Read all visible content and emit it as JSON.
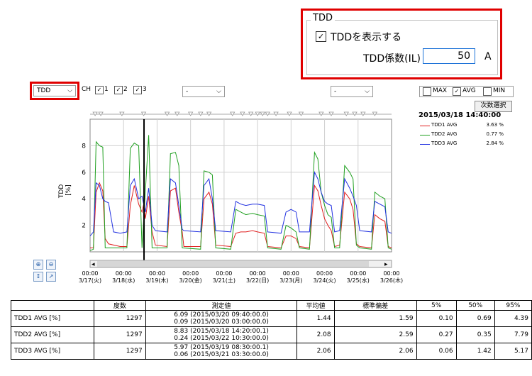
{
  "tdd_settings": {
    "group_title": "TDD",
    "show_checked": true,
    "show_label": "TDDを表示する",
    "coef_label": "TDD係数(IL)",
    "coef_value": "50",
    "coef_unit": "A"
  },
  "toolbar": {
    "mode_value": "TDD",
    "ch_label": "CH",
    "channels": [
      {
        "label": "1",
        "checked": true
      },
      {
        "label": "2",
        "checked": true
      },
      {
        "label": "3",
        "checked": true
      }
    ],
    "combo_a_value": "-",
    "combo_b_value": "-"
  },
  "stat_options": [
    {
      "label": "MAX",
      "checked": false
    },
    {
      "label": "AVG",
      "checked": true
    },
    {
      "label": "MIN",
      "checked": false
    }
  ],
  "next_button_label": "次数選択",
  "cursor_time": "2015/03/18 14:40:00",
  "legend": [
    {
      "name": "TDD1 AVG",
      "value": "3.63 %",
      "color": "#e02020"
    },
    {
      "name": "TDD2 AVG",
      "value": "0.77 %",
      "color": "#20a020"
    },
    {
      "name": "TDD3 AVG",
      "value": "2.84 %",
      "color": "#2030e0"
    }
  ],
  "chart_data": {
    "type": "line",
    "ylabel": "TDD [%]",
    "ylim": [
      0,
      10
    ],
    "yticks": [
      "2",
      "4",
      "6",
      "8"
    ],
    "x_ticks": [
      {
        "time": "00:00",
        "date": "3/17(火)"
      },
      {
        "time": "00:00",
        "date": "3/18(水)"
      },
      {
        "time": "00:00",
        "date": "3/19(木)"
      },
      {
        "time": "00:00",
        "date": "3/20(金)"
      },
      {
        "time": "00:00",
        "date": "3/21(土)"
      },
      {
        "time": "00:00",
        "date": "3/22(日)"
      },
      {
        "time": "00:00",
        "date": "3/23(月)"
      },
      {
        "time": "00:00",
        "date": "3/24(火)"
      },
      {
        "time": "00:00",
        "date": "3/25(水)"
      },
      {
        "time": "00:00",
        "date": "3/26(木)"
      }
    ],
    "x_range_days": [
      0,
      9
    ],
    "cursor_day": 1.61,
    "series": [
      {
        "name": "TDD1 AVG",
        "color": "#e02020",
        "points": [
          [
            0,
            0.3
          ],
          [
            0.1,
            0.3
          ],
          [
            0.18,
            4.5
          ],
          [
            0.28,
            5.2
          ],
          [
            0.38,
            4.6
          ],
          [
            0.45,
            1.0
          ],
          [
            0.55,
            0.6
          ],
          [
            0.9,
            0.4
          ],
          [
            1.1,
            0.4
          ],
          [
            1.2,
            3.5
          ],
          [
            1.32,
            5.0
          ],
          [
            1.45,
            3.6
          ],
          [
            1.55,
            3.0
          ],
          [
            1.6,
            3.6
          ],
          [
            1.65,
            2.5
          ],
          [
            1.75,
            4.2
          ],
          [
            1.85,
            1.5
          ],
          [
            1.95,
            0.5
          ],
          [
            2.3,
            0.4
          ],
          [
            2.4,
            4.6
          ],
          [
            2.55,
            4.8
          ],
          [
            2.65,
            3.0
          ],
          [
            2.75,
            1.5
          ],
          [
            2.8,
            0.4
          ],
          [
            3.3,
            0.4
          ],
          [
            3.4,
            4.0
          ],
          [
            3.55,
            4.5
          ],
          [
            3.65,
            3.6
          ],
          [
            3.75,
            0.5
          ],
          [
            4.2,
            0.4
          ],
          [
            4.35,
            1.4
          ],
          [
            4.5,
            1.5
          ],
          [
            4.65,
            1.5
          ],
          [
            4.85,
            1.6
          ],
          [
            5.0,
            1.5
          ],
          [
            5.2,
            1.4
          ],
          [
            5.3,
            0.4
          ],
          [
            5.7,
            0.3
          ],
          [
            5.85,
            1.2
          ],
          [
            6.0,
            1.2
          ],
          [
            6.15,
            1.0
          ],
          [
            6.25,
            0.4
          ],
          [
            6.55,
            0.3
          ],
          [
            6.7,
            5.0
          ],
          [
            6.8,
            4.6
          ],
          [
            6.9,
            3.5
          ],
          [
            7.0,
            2.5
          ],
          [
            7.1,
            2.0
          ],
          [
            7.2,
            1.6
          ],
          [
            7.3,
            0.4
          ],
          [
            7.45,
            0.5
          ],
          [
            7.6,
            4.5
          ],
          [
            7.75,
            4.0
          ],
          [
            7.85,
            3.2
          ],
          [
            7.95,
            0.6
          ],
          [
            8.05,
            0.4
          ],
          [
            8.4,
            0.3
          ],
          [
            8.5,
            2.8
          ],
          [
            8.65,
            2.5
          ],
          [
            8.8,
            2.3
          ],
          [
            8.9,
            0.4
          ],
          [
            9,
            0.3
          ]
        ]
      },
      {
        "name": "TDD2 AVG",
        "color": "#20a020",
        "points": [
          [
            0,
            0.1
          ],
          [
            0.1,
            0.2
          ],
          [
            0.18,
            8.3
          ],
          [
            0.28,
            8.0
          ],
          [
            0.38,
            7.9
          ],
          [
            0.45,
            0.3
          ],
          [
            0.9,
            0.3
          ],
          [
            1.1,
            0.3
          ],
          [
            1.2,
            7.8
          ],
          [
            1.32,
            8.2
          ],
          [
            1.45,
            8.0
          ],
          [
            1.55,
            0.3
          ],
          [
            1.75,
            8.8
          ],
          [
            1.85,
            0.3
          ],
          [
            2.3,
            0.3
          ],
          [
            2.4,
            7.4
          ],
          [
            2.55,
            7.5
          ],
          [
            2.65,
            6.5
          ],
          [
            2.75,
            0.3
          ],
          [
            3.3,
            0.2
          ],
          [
            3.4,
            6.1
          ],
          [
            3.55,
            6.0
          ],
          [
            3.65,
            5.8
          ],
          [
            3.75,
            0.3
          ],
          [
            4.2,
            0.2
          ],
          [
            4.35,
            3.2
          ],
          [
            4.5,
            3.0
          ],
          [
            4.65,
            2.8
          ],
          [
            4.85,
            2.9
          ],
          [
            5.0,
            2.8
          ],
          [
            5.2,
            2.7
          ],
          [
            5.3,
            0.3
          ],
          [
            5.7,
            0.2
          ],
          [
            5.85,
            2.0
          ],
          [
            6.0,
            1.8
          ],
          [
            6.15,
            1.5
          ],
          [
            6.25,
            0.3
          ],
          [
            6.55,
            0.2
          ],
          [
            6.7,
            7.5
          ],
          [
            6.8,
            7.0
          ],
          [
            6.9,
            4.5
          ],
          [
            7.0,
            3.5
          ],
          [
            7.1,
            2.8
          ],
          [
            7.2,
            2.6
          ],
          [
            7.3,
            0.3
          ],
          [
            7.45,
            0.3
          ],
          [
            7.6,
            6.5
          ],
          [
            7.75,
            6.0
          ],
          [
            7.85,
            5.5
          ],
          [
            7.95,
            0.5
          ],
          [
            8.05,
            0.3
          ],
          [
            8.4,
            0.2
          ],
          [
            8.5,
            4.5
          ],
          [
            8.65,
            4.2
          ],
          [
            8.8,
            4.0
          ],
          [
            8.9,
            0.3
          ],
          [
            9,
            0.2
          ]
        ]
      },
      {
        "name": "TDD3 AVG",
        "color": "#2030e0",
        "points": [
          [
            0,
            1.2
          ],
          [
            0.1,
            1.5
          ],
          [
            0.18,
            5.2
          ],
          [
            0.28,
            5.0
          ],
          [
            0.38,
            4.0
          ],
          [
            0.45,
            3.8
          ],
          [
            0.55,
            3.7
          ],
          [
            0.7,
            1.5
          ],
          [
            0.9,
            1.4
          ],
          [
            1.1,
            1.5
          ],
          [
            1.2,
            5.0
          ],
          [
            1.32,
            5.5
          ],
          [
            1.45,
            4.0
          ],
          [
            1.55,
            4.2
          ],
          [
            1.65,
            3.0
          ],
          [
            1.75,
            4.8
          ],
          [
            1.85,
            2.0
          ],
          [
            1.95,
            1.6
          ],
          [
            2.3,
            1.5
          ],
          [
            2.4,
            5.5
          ],
          [
            2.55,
            5.2
          ],
          [
            2.65,
            3.5
          ],
          [
            2.75,
            1.7
          ],
          [
            2.8,
            1.6
          ],
          [
            3.3,
            1.5
          ],
          [
            3.4,
            5.0
          ],
          [
            3.55,
            5.5
          ],
          [
            3.65,
            4.0
          ],
          [
            3.75,
            1.6
          ],
          [
            4.2,
            1.5
          ],
          [
            4.35,
            3.8
          ],
          [
            4.5,
            3.6
          ],
          [
            4.65,
            3.5
          ],
          [
            4.85,
            3.6
          ],
          [
            5.0,
            3.6
          ],
          [
            5.2,
            3.5
          ],
          [
            5.3,
            1.5
          ],
          [
            5.7,
            1.4
          ],
          [
            5.85,
            3.0
          ],
          [
            6.0,
            3.2
          ],
          [
            6.15,
            3.0
          ],
          [
            6.25,
            1.5
          ],
          [
            6.55,
            1.5
          ],
          [
            6.7,
            6.0
          ],
          [
            6.8,
            5.5
          ],
          [
            6.9,
            4.5
          ],
          [
            7.0,
            3.8
          ],
          [
            7.1,
            3.6
          ],
          [
            7.2,
            3.5
          ],
          [
            7.3,
            1.5
          ],
          [
            7.45,
            1.6
          ],
          [
            7.6,
            5.5
          ],
          [
            7.75,
            4.8
          ],
          [
            7.85,
            4.2
          ],
          [
            7.95,
            3.5
          ],
          [
            8.05,
            1.6
          ],
          [
            8.4,
            1.5
          ],
          [
            8.5,
            3.8
          ],
          [
            8.65,
            3.6
          ],
          [
            8.8,
            3.4
          ],
          [
            8.9,
            1.5
          ],
          [
            9,
            1.4
          ]
        ]
      }
    ]
  },
  "table": {
    "headers": [
      "",
      "度数",
      "測定値",
      "平均値",
      "標準偏差",
      "5%",
      "50%",
      "95%"
    ],
    "rows": [
      {
        "name": "TDD1 AVG [%]",
        "count": "1297",
        "m1": "6.09 (2015/03/20 09:40:00.0)",
        "m2": "0.09 (2015/03/20 03:00:00.0)",
        "avg": "1.44",
        "sd": "1.59",
        "p5": "0.10",
        "p50": "0.69",
        "p95": "4.39"
      },
      {
        "name": "TDD2 AVG [%]",
        "count": "1297",
        "m1": "8.83 (2015/03/18 14:20:00.1)",
        "m2": "0.24 (2015/03/22 10:30:00.0)",
        "avg": "2.08",
        "sd": "2.59",
        "p5": "0.27",
        "p50": "0.35",
        "p95": "7.79"
      },
      {
        "name": "TDD3 AVG [%]",
        "count": "1297",
        "m1": "5.97 (2015/03/19 08:30:00.1)",
        "m2": "0.06 (2015/03/21 03:30:00.0)",
        "avg": "2.06",
        "sd": "2.06",
        "p5": "0.06",
        "p50": "1.42",
        "p95": "5.17"
      }
    ]
  }
}
